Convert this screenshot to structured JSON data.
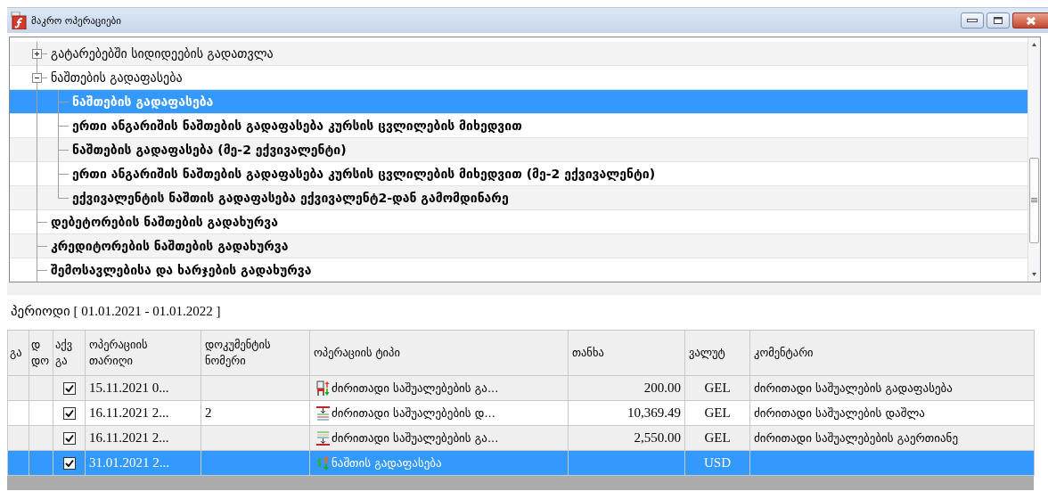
{
  "window": {
    "title": "მაკრო ოპერაციები"
  },
  "tree": {
    "items": [
      {
        "label": "გატარებებში სიდიდეების გადათვლა",
        "kind": "group",
        "expanded": false,
        "selected": false
      },
      {
        "label": "ნაშთების გადაფასება",
        "kind": "group",
        "expanded": true,
        "selected": false,
        "children": [
          {
            "label": "ნაშთების გადაფასება",
            "kind": "operation",
            "selected": true
          },
          {
            "label": "ერთი ანგარიშის ნაშთების გადაფასება კურსის ცვლილების მიხედვით",
            "kind": "operation",
            "selected": false
          },
          {
            "label": "ნაშთების გადაფასება (მე-2 ექვივალენტი)",
            "kind": "operation",
            "selected": false
          },
          {
            "label": "ერთი ანგარიშის ნაშთების გადაფასება კურსის ცვლილების მიხედვით (მე-2 ექვივალენტი)",
            "kind": "operation",
            "selected": false
          },
          {
            "label": "ექვივალენტის ნაშთის გადაფასება ექვივალენტ2-დან გამომდინარე",
            "kind": "operation",
            "selected": false
          }
        ]
      },
      {
        "label": "დებეტორების ნაშთების გადახურვა",
        "kind": "operation",
        "selected": false
      },
      {
        "label": "კრედიტორების ნაშთების გადახურვა",
        "kind": "operation",
        "selected": false
      },
      {
        "label": "შემოსავლებისა და ხარჯების გადახურვა",
        "kind": "operation",
        "selected": false
      }
    ]
  },
  "period": {
    "label": "პერიოდი [ 01.01.2021 - 01.01.2022 ]"
  },
  "table": {
    "columns": [
      "გა",
      "დ\nდო",
      "აქვ\nგა",
      "ოპერაციის\nთარიღი",
      "დოკუმენტის\nნომერი",
      "ოპერაციის ტიპი",
      "თანხა",
      "ვალუტ",
      "კომენტარი"
    ],
    "rows": [
      {
        "checked": true,
        "date": "15.11.2021 0...",
        "kind": "transfer",
        "operation_type": "ძირითადი საშუალებების გა...",
        "amount": "200.00",
        "currency": "GEL",
        "comment": "ძირითადი საშუალების გადაფასება",
        "selected": false
      },
      {
        "checked": true,
        "date": "16.11.2021 2...",
        "document_number": "2",
        "kind": "writeoff",
        "operation_type": "ძირითადი საშუალებების დ...",
        "amount": "10,369.49",
        "currency": "GEL",
        "comment": "ძირითადი საშუალების დაშლა",
        "selected": false
      },
      {
        "checked": true,
        "date": "16.11.2021 2...",
        "kind": "merge",
        "operation_type": "ძირითადი საშუალებების გა...",
        "amount": "2,550.00",
        "currency": "GEL",
        "comment": "ძირითადი საშუალებების გაერთიანე",
        "selected": false
      },
      {
        "checked": true,
        "date": "31.01.2021 2...",
        "kind": "revaluation",
        "operation_type": "ნაშთის გადაფასება",
        "currency": "USD",
        "selected": true
      }
    ]
  }
}
